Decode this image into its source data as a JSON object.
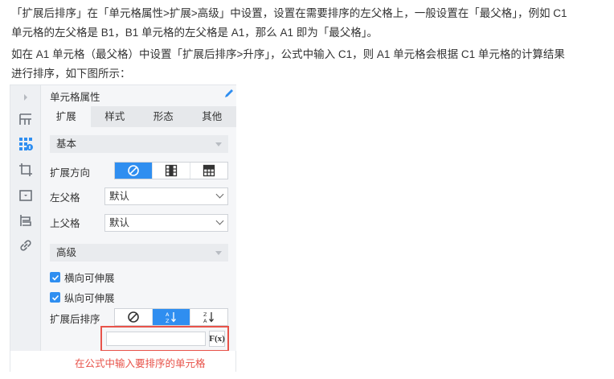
{
  "article": {
    "p1_line1": "「扩展后排序」在「单元格属性>扩展>高级」中设置，设置在需要排序的左父格上，一般设置在「最父格」，例如 C1",
    "p1_line2": "单元格的左父格是 B1，B1 单元格的左父格是 A1，那么 A1 即为「最父格」。",
    "p2_line1": "如在 A1 单元格（最父格）中设置「扩展后排序>升序」，公式中输入 C1，则 A1 单元格会根据 C1 单元格的计算结果",
    "p2_line2": "进行排序，如下图所示："
  },
  "panel": {
    "title": "单元格属性",
    "tabs": [
      {
        "label": "扩展",
        "active": true
      },
      {
        "label": "样式",
        "active": false
      },
      {
        "label": "形态",
        "active": false
      },
      {
        "label": "其他",
        "active": false
      }
    ],
    "section_basic": "基本",
    "expand_direction_label": "扩展方向",
    "left_parent_label": "左父格",
    "left_parent_value": "默认",
    "top_parent_label": "上父格",
    "top_parent_value": "默认",
    "section_advanced": "高级",
    "horizontal_expandable": "横向可伸展",
    "vertical_expandable": "纵向可伸展",
    "sort_after_expand_label": "扩展后排序",
    "formula_button": "F(x)",
    "formula_value": "",
    "caption": "在公式中输入要排序的单元格"
  },
  "colors": {
    "accent": "#2f8ef0",
    "highlight": "#e8534a"
  }
}
